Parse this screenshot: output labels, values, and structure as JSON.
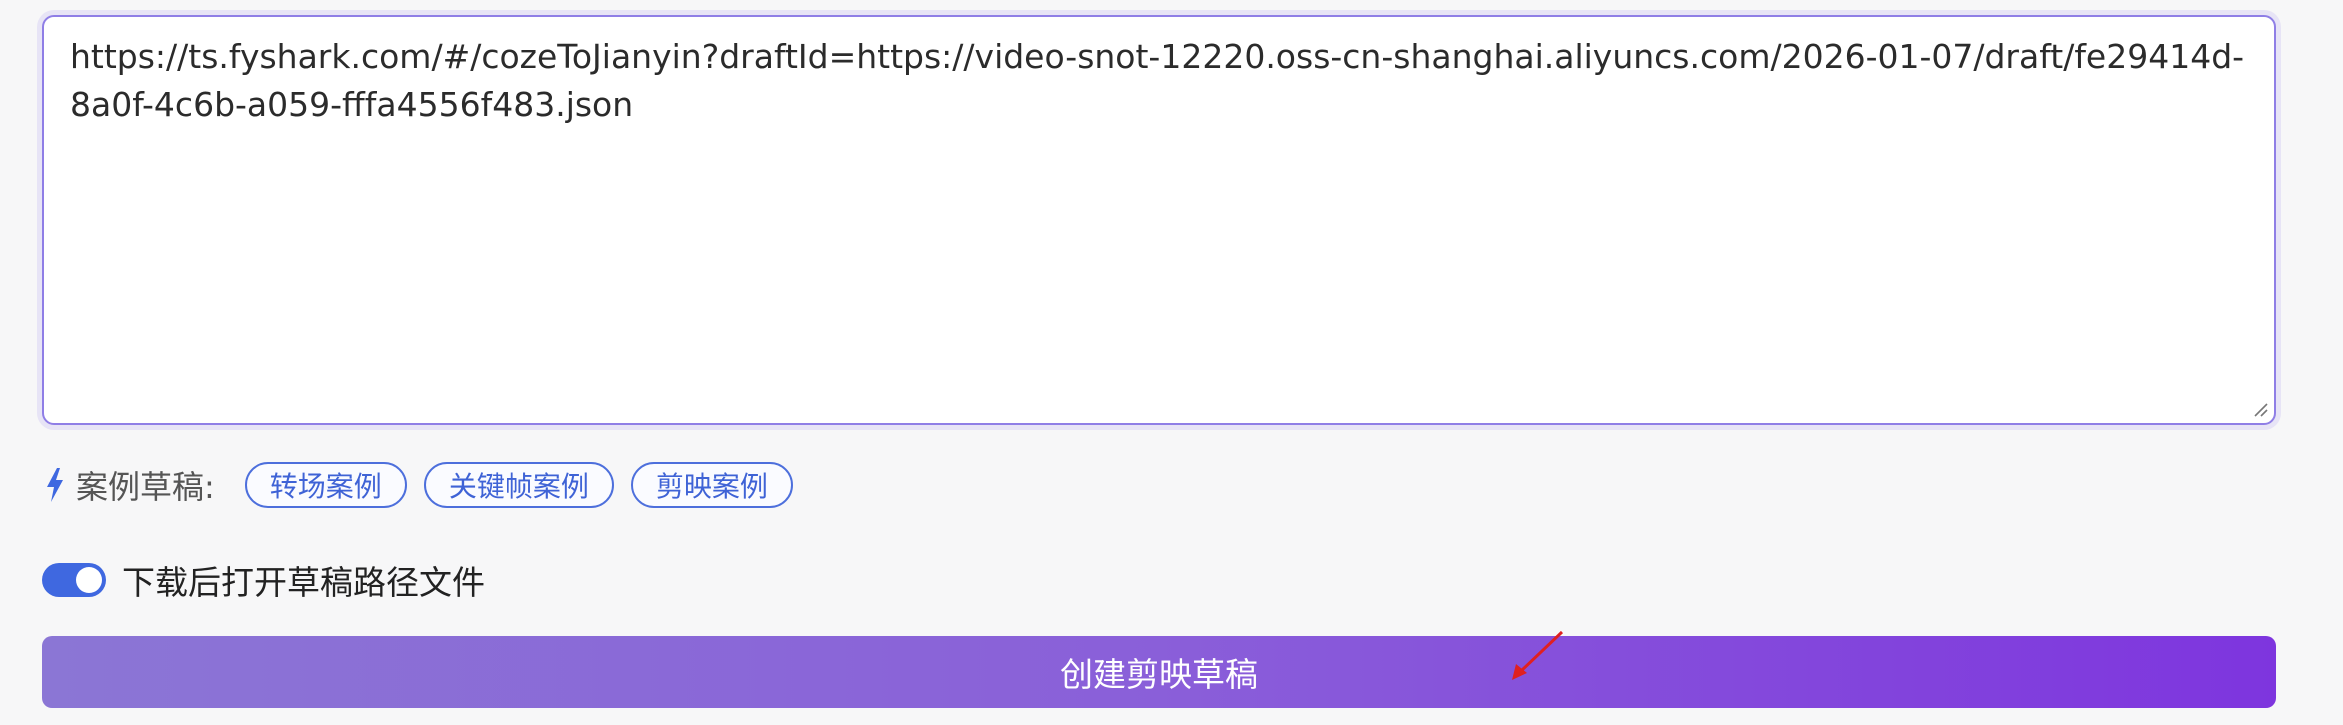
{
  "url_input": {
    "value": "https://ts.fyshark.com/#/cozeToJianyin?draftId=https://video-snot-12220.oss-cn-shanghai.aliyuncs.com/2026-01-07/draft/fe29414d-8a0f-4c6b-a059-fffa4556f483.json"
  },
  "examples": {
    "icon": "lightning-icon",
    "label": "案例草稿:",
    "chips": [
      {
        "label": "转场案例"
      },
      {
        "label": "关键帧案例"
      },
      {
        "label": "剪映案例"
      }
    ]
  },
  "open_after_download": {
    "enabled": true,
    "label": "下载后打开草稿路径文件"
  },
  "create_button": {
    "label": "创建剪映草稿"
  },
  "colors": {
    "accent_blue": "#3f68e0",
    "button_gradient_start": "#8b76d5",
    "button_gradient_end": "#7e35de",
    "annotation_arrow": "#e02020"
  }
}
